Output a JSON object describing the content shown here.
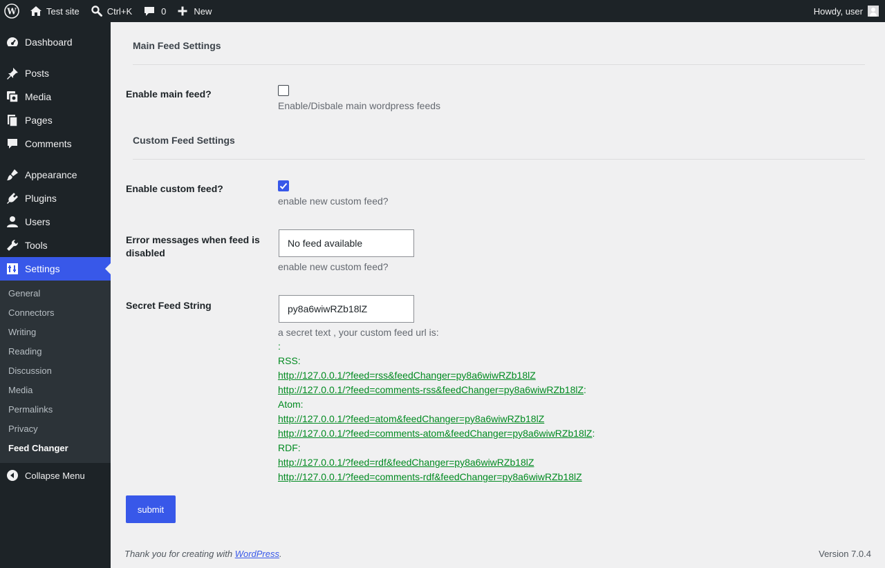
{
  "admin_bar": {
    "site_name": "Test site",
    "search_shortcut": "Ctrl+K",
    "comments_count": "0",
    "new_label": "New",
    "greeting": "Howdy, user"
  },
  "sidebar": {
    "items": [
      {
        "label": "Dashboard",
        "icon": "dashboard-icon"
      },
      {
        "label": "Posts",
        "icon": "pin-icon"
      },
      {
        "label": "Media",
        "icon": "media-icon"
      },
      {
        "label": "Pages",
        "icon": "pages-icon"
      },
      {
        "label": "Comments",
        "icon": "comment-icon"
      },
      {
        "label": "Appearance",
        "icon": "brush-icon"
      },
      {
        "label": "Plugins",
        "icon": "plug-icon"
      },
      {
        "label": "Users",
        "icon": "user-icon"
      },
      {
        "label": "Tools",
        "icon": "wrench-icon"
      },
      {
        "label": "Settings",
        "icon": "settings-icon"
      }
    ],
    "submenu": [
      "General",
      "Connectors",
      "Writing",
      "Reading",
      "Discussion",
      "Media",
      "Permalinks",
      "Privacy",
      "Feed Changer"
    ],
    "collapse_label": "Collapse Menu",
    "accent_color": "#3858e9"
  },
  "main": {
    "main_section_title": "Main Feed Settings",
    "enable_main_label": "Enable main feed?",
    "enable_main_checked": false,
    "enable_main_desc": "Enable/Disbale main wordpress feeds",
    "custom_section_title": "Custom Feed Settings",
    "enable_custom_label": "Enable custom feed?",
    "enable_custom_checked": true,
    "enable_custom_desc": "enable new custom feed?",
    "error_label": "Error messages when feed is disabled",
    "error_value": "No feed available",
    "error_desc": "enable new custom feed?",
    "secret_label": "Secret Feed String",
    "secret_value": "py8a6wiwRZb18lZ",
    "secret_desc": "a secret text , your custom feed url is:",
    "colon": ":",
    "rss_label": "RSS:",
    "rss_url": "http://127.0.0.1/?feed=rss&feedChanger=py8a6wiwRZb18lZ",
    "rss_comments_url": "http://127.0.0.1/?feed=comments-rss&feedChanger=py8a6wiwRZb18lZ",
    "atom_label": "Atom:",
    "atom_url": "http://127.0.0.1/?feed=atom&feedChanger=py8a6wiwRZb18lZ",
    "atom_comments_url": "http://127.0.0.1/?feed=comments-atom&feedChanger=py8a6wiwRZb18lZ",
    "rdf_label": "RDF:",
    "rdf_url": "http://127.0.0.1/?feed=rdf&feedChanger=py8a6wiwRZb18lZ",
    "rdf_comments_url": "http://127.0.0.1/?feed=comments-rdf&feedChanger=py8a6wiwRZb18lZ",
    "submit_label": "submit"
  },
  "footer": {
    "thanks_prefix": "Thank you for creating with ",
    "wordpress_link": "WordPress",
    "thanks_suffix": ".",
    "version": "Version 7.0.4"
  }
}
